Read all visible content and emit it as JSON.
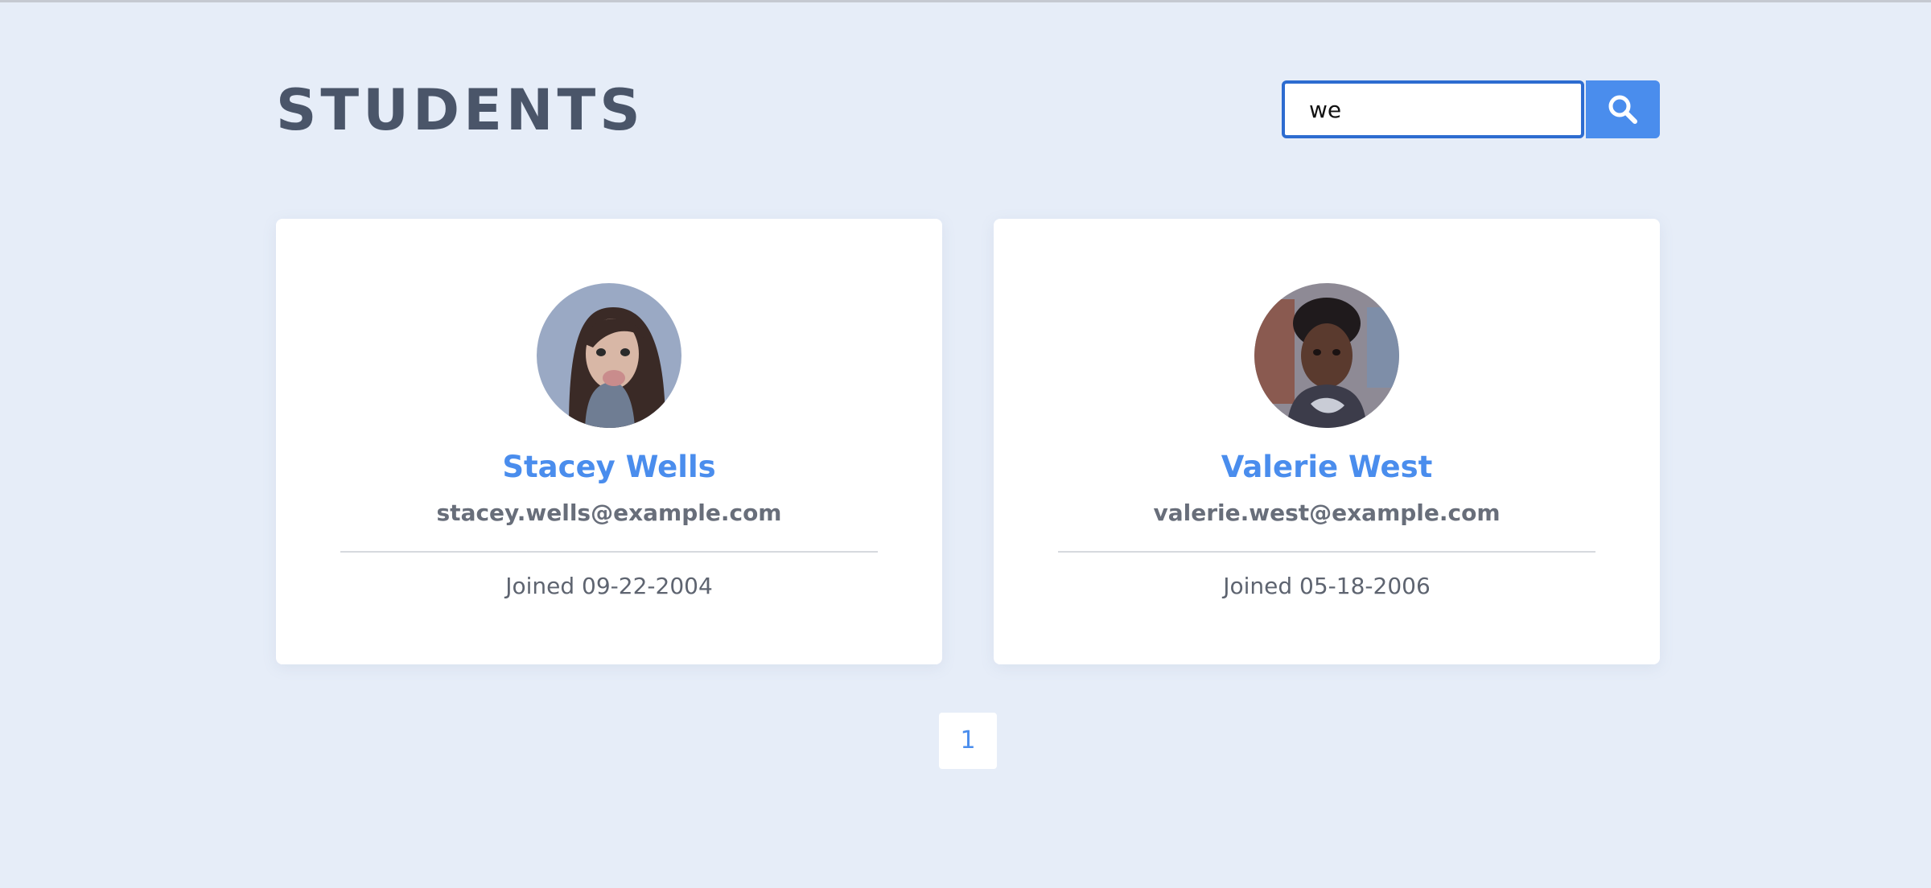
{
  "page": {
    "title": "STUDENTS"
  },
  "search": {
    "value": "we",
    "button_icon": "search-icon"
  },
  "students": [
    {
      "name": "Stacey Wells",
      "email": "stacey.wells@example.com",
      "joined": "Joined 09-22-2004",
      "avatar_icon": "avatar"
    },
    {
      "name": "Valerie West",
      "email": "valerie.west@example.com",
      "joined": "Joined 05-18-2006",
      "avatar_icon": "avatar"
    }
  ],
  "pagination": {
    "pages": [
      "1"
    ]
  },
  "colors": {
    "background": "#e6edf8",
    "accent": "#4a8ded",
    "title": "#4a5569",
    "input_border": "#2d6cd0"
  }
}
